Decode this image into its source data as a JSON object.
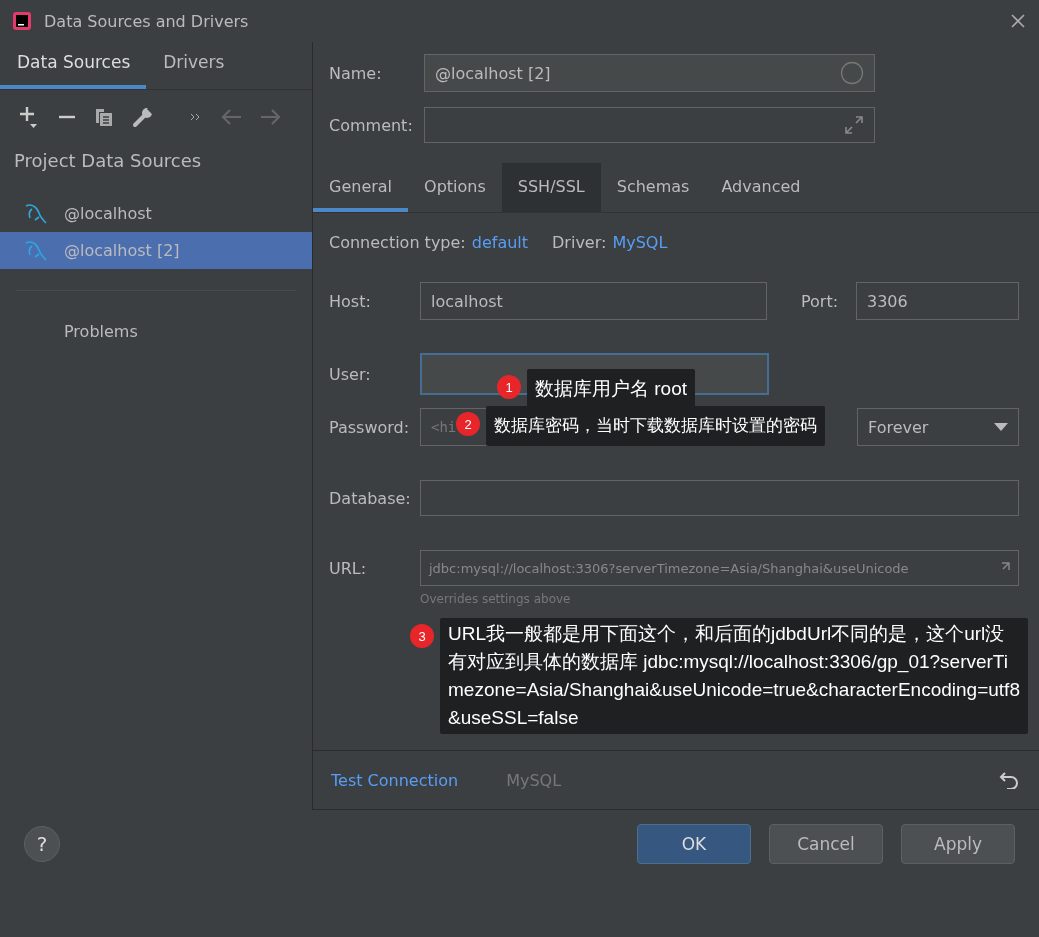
{
  "window": {
    "title": "Data Sources and Drivers"
  },
  "sidebar": {
    "tabs": [
      {
        "label": "Data Sources",
        "selected": true
      },
      {
        "label": "Drivers",
        "selected": false
      }
    ],
    "section_title": "Project Data Sources",
    "items": [
      {
        "label": "@localhost",
        "selected": false
      },
      {
        "label": "@localhost [2]",
        "selected": true
      }
    ],
    "problems": "Problems"
  },
  "form": {
    "name_label": "Name:",
    "name_value": "@localhost [2]",
    "comment_label": "Comment:",
    "tabs": [
      {
        "label": "General",
        "selected": true,
        "hovered": false
      },
      {
        "label": "Options",
        "selected": false,
        "hovered": false
      },
      {
        "label": "SSH/SSL",
        "selected": false,
        "hovered": true
      },
      {
        "label": "Schemas",
        "selected": false,
        "hovered": false
      },
      {
        "label": "Advanced",
        "selected": false,
        "hovered": false
      }
    ],
    "connection_type_label": "Connection type:",
    "connection_type": "default",
    "driver_label": "Driver:",
    "driver": "MySQL",
    "host_label": "Host:",
    "host": "localhost",
    "port_label": "Port:",
    "port": "3306",
    "user_label": "User:",
    "user_focused": true,
    "password_label": "Password:",
    "password": "<hi",
    "save": "Forever",
    "database_label": "Database:",
    "url_label": "URL:",
    "url": "jdbc:mysql://localhost:3306?serverTimezone=Asia/Shanghai&useUnicode",
    "url_hint": "Overrides settings above"
  },
  "footer": {
    "help": "?",
    "test_connection": "Test Connection",
    "driver_name": "MySQL",
    "buttons": [
      {
        "label": "OK",
        "primary": true
      },
      {
        "label": "Cancel",
        "primary": false
      },
      {
        "label": "Apply",
        "primary": false
      }
    ]
  },
  "annotations": [
    {
      "number": "1",
      "text": "数据库用户名 root"
    },
    {
      "number": "2",
      "text": "数据库密码，当时下载数据库时设置的密码"
    },
    {
      "number": "3",
      "text": "URL我一般都是用下面这个，和后面的jdbdUrl不同的是，这个url没有对应到具体的数据库 jdbc:mysql://localhost:3306/gp_01?serverTimezone=Asia/Shanghai&useUnicode=true&characterEncoding=utf8&useSSL=false"
    }
  ]
}
